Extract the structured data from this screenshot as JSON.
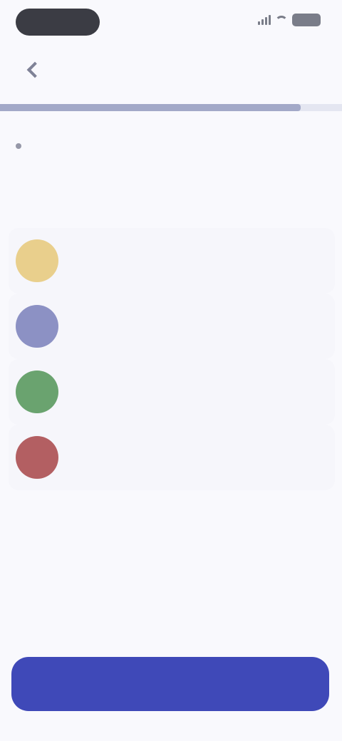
{
  "status_bar": {
    "time": "",
    "icons": [
      "signal-icon",
      "wifi-icon",
      "battery-icon"
    ]
  },
  "header": {
    "back_icon": "chevron-left-icon",
    "skip_label": ""
  },
  "progress": {
    "fraction": 0.88
  },
  "question": {
    "title": "",
    "subtitle": ""
  },
  "options": [
    {
      "label": "",
      "caption": "",
      "color": "#e9cf8c",
      "icon": "option-icon"
    },
    {
      "label": "",
      "caption": "",
      "color": "#8c91c4",
      "icon": "option-icon"
    },
    {
      "label": "",
      "caption": "",
      "color": "#6aa36f",
      "icon": "option-icon"
    },
    {
      "label": "",
      "caption": "",
      "color": "#b35f62",
      "icon": "option-icon"
    }
  ],
  "continue_button": {
    "label": ""
  },
  "colors": {
    "accent": "#3f49b8",
    "background": "#f9f9fd",
    "progress_fill": "#a3a9c8"
  }
}
